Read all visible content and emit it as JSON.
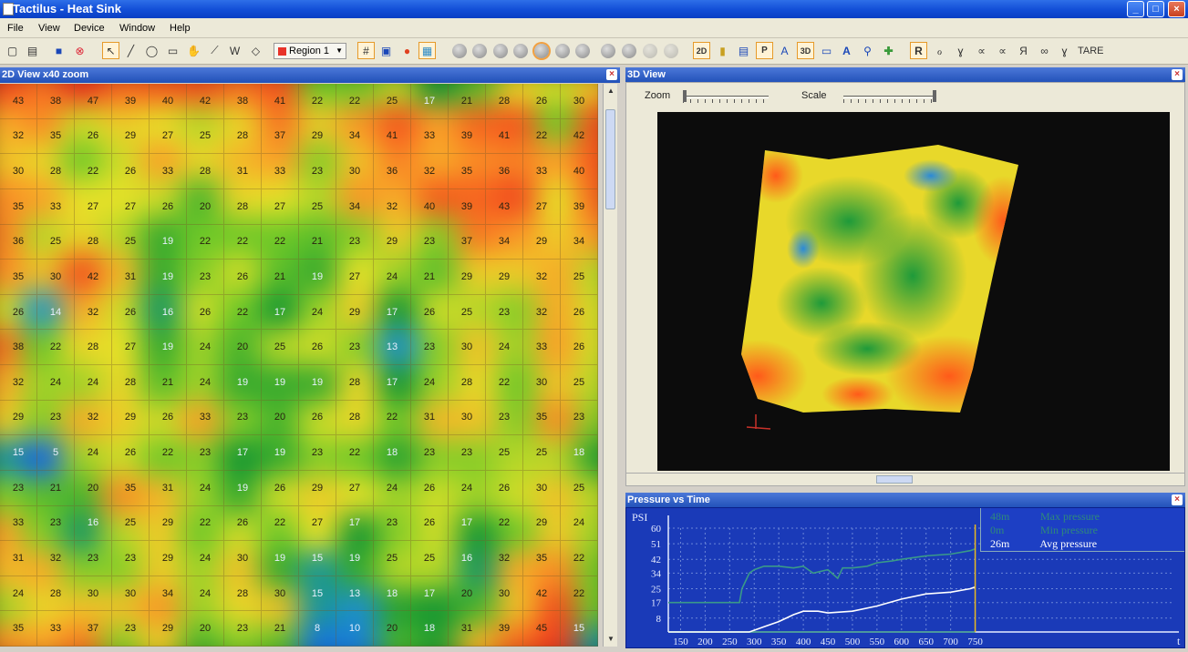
{
  "window": {
    "title": "Tactilus - Heat Sink"
  },
  "menu": [
    "File",
    "View",
    "Device",
    "Window",
    "Help"
  ],
  "toolbar": {
    "region_label": "Region 1",
    "region_color": "#e8332a",
    "tare_label": "TARE"
  },
  "view2d": {
    "title": "2D View   x40 zoom",
    "grid": [
      [
        43,
        38,
        47,
        39,
        40,
        42,
        38,
        41,
        22,
        22,
        25,
        17,
        21,
        28,
        26,
        30
      ],
      [
        32,
        35,
        26,
        29,
        27,
        25,
        28,
        37,
        29,
        34,
        41,
        33,
        39,
        41,
        22,
        42
      ],
      [
        30,
        28,
        22,
        26,
        33,
        28,
        31,
        33,
        23,
        30,
        36,
        32,
        35,
        36,
        33,
        40
      ],
      [
        35,
        33,
        27,
        27,
        26,
        20,
        28,
        27,
        25,
        34,
        32,
        40,
        39,
        43,
        27,
        39
      ],
      [
        36,
        25,
        28,
        25,
        19,
        22,
        22,
        22,
        21,
        23,
        29,
        23,
        37,
        34,
        29,
        34
      ],
      [
        35,
        30,
        42,
        31,
        19,
        23,
        26,
        21,
        19,
        27,
        24,
        21,
        29,
        29,
        32,
        25
      ],
      [
        26,
        14,
        32,
        26,
        16,
        26,
        22,
        17,
        24,
        29,
        17,
        26,
        25,
        23,
        32,
        26
      ],
      [
        38,
        22,
        28,
        27,
        19,
        24,
        20,
        25,
        26,
        23,
        13,
        23,
        30,
        24,
        33,
        26
      ],
      [
        32,
        24,
        24,
        28,
        21,
        24,
        19,
        19,
        19,
        28,
        17,
        24,
        28,
        22,
        30,
        25
      ],
      [
        29,
        23,
        32,
        29,
        26,
        33,
        23,
        20,
        26,
        28,
        22,
        31,
        30,
        23,
        35,
        23
      ],
      [
        15,
        5,
        24,
        26,
        22,
        23,
        17,
        19,
        23,
        22,
        18,
        23,
        23,
        25,
        25,
        18
      ],
      [
        23,
        21,
        20,
        35,
        31,
        24,
        19,
        26,
        29,
        27,
        24,
        26,
        24,
        26,
        30,
        25
      ],
      [
        33,
        23,
        16,
        25,
        29,
        22,
        26,
        22,
        27,
        17,
        23,
        26,
        17,
        22,
        29,
        24
      ],
      [
        31,
        32,
        23,
        23,
        29,
        24,
        30,
        19,
        15,
        19,
        25,
        25,
        16,
        32,
        35,
        22
      ],
      [
        24,
        28,
        30,
        30,
        34,
        24,
        28,
        30,
        15,
        13,
        18,
        17,
        20,
        30,
        42,
        22
      ],
      [
        35,
        33,
        37,
        23,
        29,
        20,
        23,
        21,
        8,
        10,
        20,
        18,
        31,
        39,
        45,
        15
      ]
    ]
  },
  "view3d": {
    "title": "3D View",
    "zoom_label": "Zoom",
    "scale_label": "Scale"
  },
  "pvt": {
    "title": "Pressure vs Time",
    "y_unit": "PSI",
    "x_unit": "t",
    "legend": [
      {
        "value": "48m",
        "label": "Max pressure",
        "color": "#2f8a7a"
      },
      {
        "value": "0m",
        "label": "Min pressure",
        "color": "#2f8a7a"
      },
      {
        "value": "26m",
        "label": "Avg pressure",
        "color": "#ffffff"
      }
    ]
  },
  "chart_data": {
    "type": "line",
    "ylabel": "PSI",
    "xlabel": "t",
    "y_ticks": [
      "60",
      "51",
      "42",
      "34",
      "25",
      "17",
      "8"
    ],
    "x_ticks": [
      "150",
      "200",
      "250",
      "300",
      "350",
      "400",
      "450",
      "500",
      "550",
      "600",
      "650",
      "700",
      "750"
    ],
    "ylim": [
      0,
      60
    ],
    "xlim": [
      125,
      1150
    ],
    "cursor_x": 750,
    "series": [
      {
        "name": "Max pressure",
        "color": "#3a9a88",
        "x": [
          125,
          150,
          200,
          250,
          270,
          275,
          290,
          300,
          320,
          350,
          380,
          400,
          420,
          450,
          470,
          480,
          500,
          530,
          550,
          580,
          600,
          650,
          700,
          740,
          750
        ],
        "y": [
          17,
          17,
          17,
          17,
          17,
          25,
          34,
          36,
          38,
          38,
          37,
          38,
          34,
          36,
          31,
          37,
          37,
          38,
          40,
          41,
          42,
          44,
          45,
          47,
          48
        ]
      },
      {
        "name": "Min pressure",
        "color": "#3a9a88",
        "x": [
          125,
          750
        ],
        "y": [
          0,
          0
        ]
      },
      {
        "name": "Avg pressure",
        "color": "#ffffff",
        "x": [
          125,
          250,
          290,
          300,
          320,
          350,
          380,
          400,
          430,
          450,
          500,
          550,
          600,
          650,
          700,
          740,
          750
        ],
        "y": [
          0,
          0,
          0,
          1,
          3,
          6,
          10,
          12,
          12,
          11,
          12,
          15,
          19,
          22,
          23,
          25,
          26
        ]
      }
    ]
  }
}
